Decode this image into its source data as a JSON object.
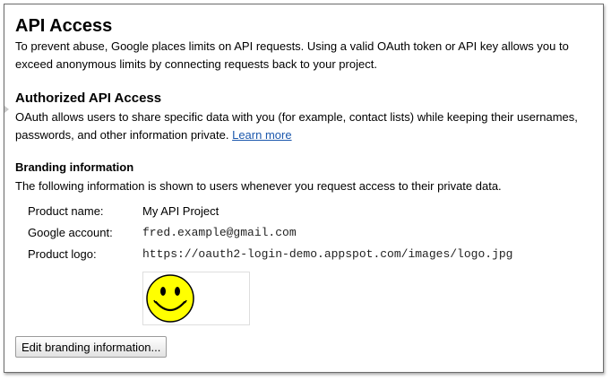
{
  "page": {
    "title": "API Access",
    "intro": "To prevent abuse, Google places limits on API requests. Using a valid OAuth token or API key allows you to exceed anonymous limits by connecting requests back to your project."
  },
  "authorized": {
    "title": "Authorized API Access",
    "text": "OAuth allows users to share specific data with you (for example, contact lists) while keeping their usernames, passwords, and other information private.",
    "learn_more": "Learn more"
  },
  "branding": {
    "title": "Branding information",
    "description": "The following information is shown to users whenever you request access to their private data.",
    "rows": [
      {
        "label": "Product name:",
        "value": "My API Project"
      },
      {
        "label": "Google account:",
        "value": "fred.example@gmail.com"
      },
      {
        "label": "Product logo:",
        "value": "https://oauth2-login-demo.appspot.com/images/logo.jpg"
      }
    ],
    "logo_icon": "smiley-face-icon",
    "edit_button": "Edit branding information..."
  },
  "colors": {
    "link": "#1c58ad",
    "smiley_face": "#ffff00"
  }
}
